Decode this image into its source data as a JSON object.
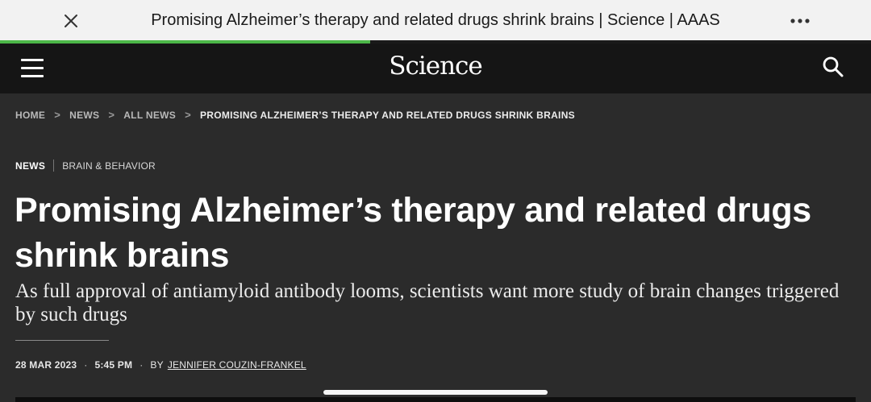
{
  "browser": {
    "title": "Promising Alzheimer’s therapy and related drugs shrink brains | Science | AAAS",
    "close_icon": "close-icon",
    "more_icon": "more-horizontal-icon",
    "progress": 0.425,
    "progress_color": "#4cb748"
  },
  "header": {
    "logo": "Science",
    "menu_icon": "hamburger-menu-icon",
    "search_icon": "search-icon"
  },
  "breadcrumb": {
    "items": [
      "HOME",
      "NEWS",
      "ALL NEWS",
      "PROMISING ALZHEIMER’S THERAPY AND RELATED DRUGS SHRINK BRAINS"
    ],
    "separator": ">"
  },
  "article": {
    "section": "NEWS",
    "topic": "BRAIN & BEHAVIOR",
    "headline": "Promising Alzheimer’s therapy and related drugs shrink brains",
    "subhead": "As full approval of antiamyloid antibody looms, scientists want more study of brain changes triggered by such drugs",
    "date": "28 MAR 2023",
    "time": "5:45 PM",
    "by": "BY",
    "author": "JENNIFER COUZIN-FRANKEL",
    "dot": "·"
  }
}
